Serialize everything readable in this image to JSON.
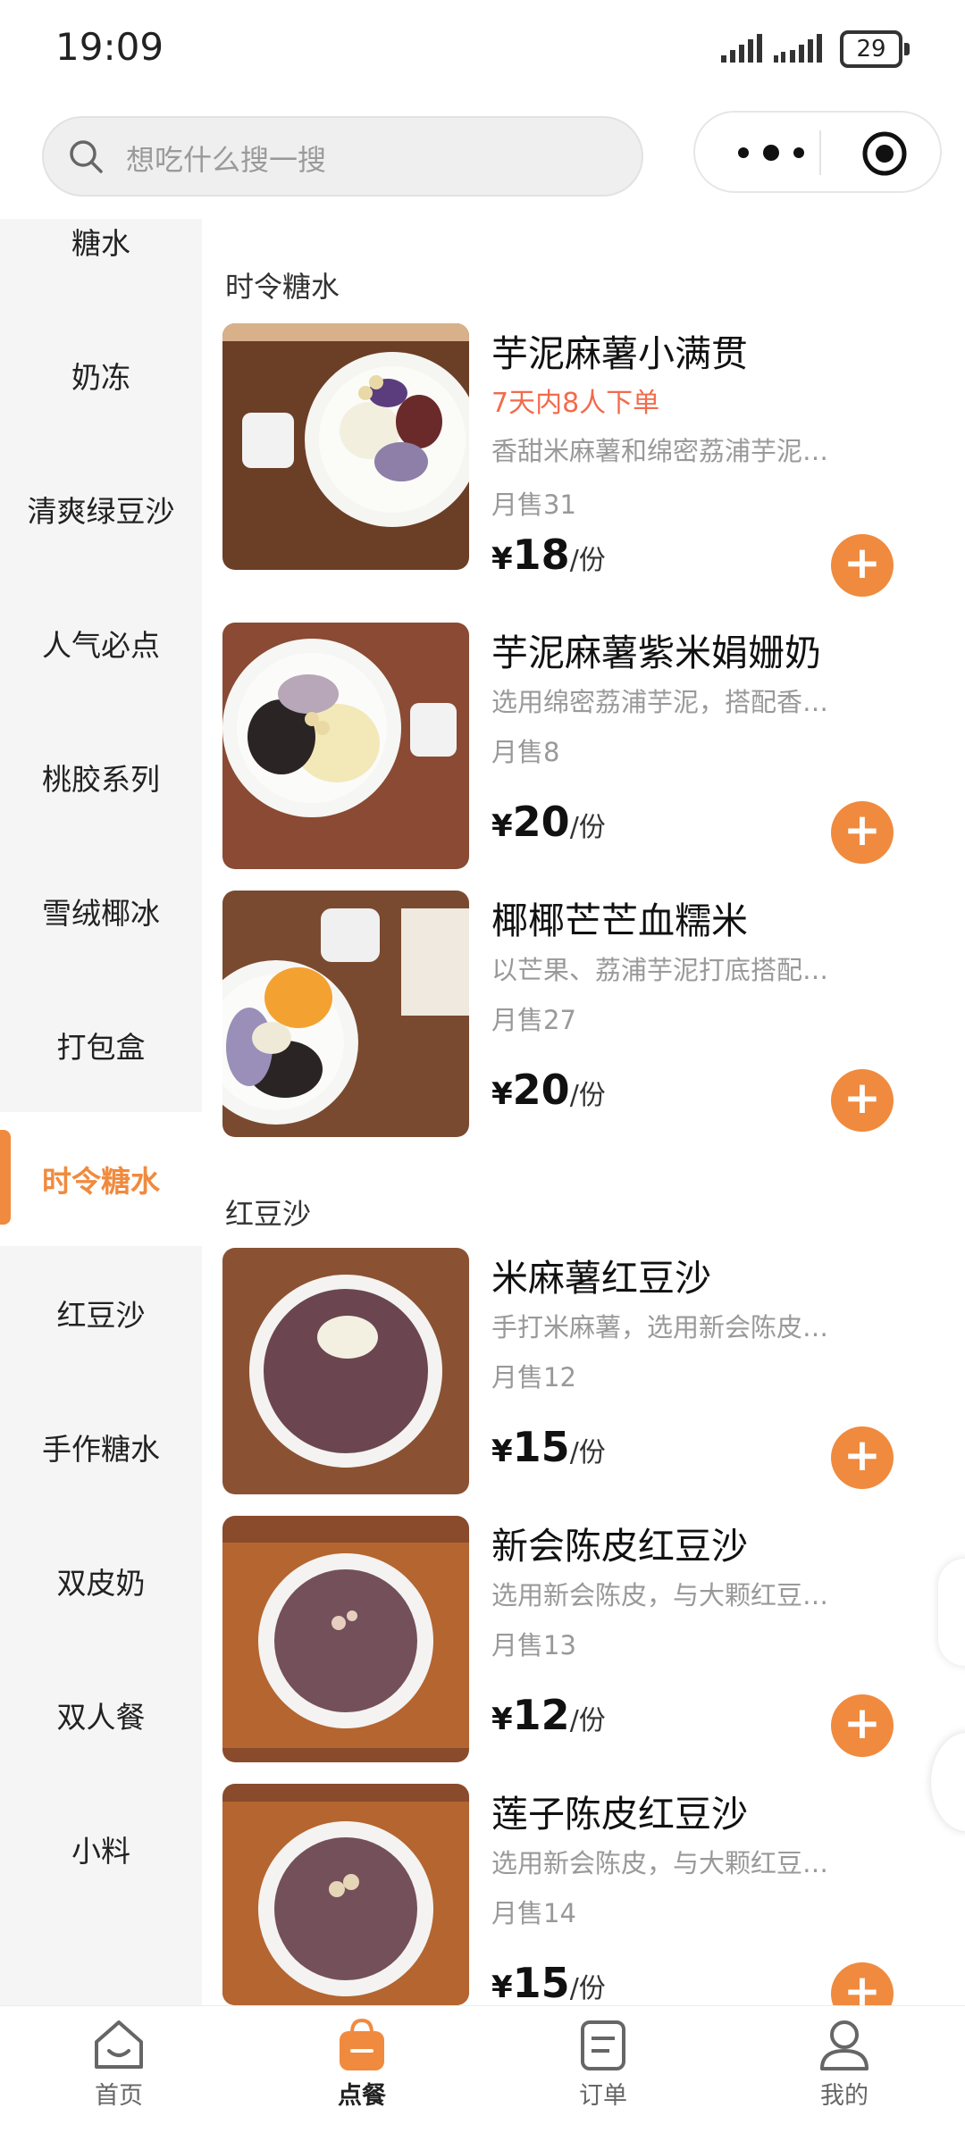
{
  "status_bar": {
    "time": "19:09",
    "battery": "29"
  },
  "search": {
    "placeholder": "想吃什么搜一搜"
  },
  "sidebar": {
    "items": [
      {
        "label": "糖水"
      },
      {
        "label": "奶冻"
      },
      {
        "label": "清爽绿豆沙"
      },
      {
        "label": "人气必点"
      },
      {
        "label": "桃胶系列"
      },
      {
        "label": "雪绒椰冰"
      },
      {
        "label": "打包盒"
      },
      {
        "label": "时令糖水",
        "active": true
      },
      {
        "label": "红豆沙"
      },
      {
        "label": "手作糖水"
      },
      {
        "label": "双皮奶"
      },
      {
        "label": "双人餐"
      },
      {
        "label": "小料"
      }
    ]
  },
  "sections": [
    {
      "title": "时令糖水",
      "items": [
        {
          "name": "芋泥麻薯小满贯",
          "tag": "7天内8人下单",
          "desc": "香甜米麻薯和绵密荔浦芋泥结…",
          "sales": "月售31",
          "currency": "¥",
          "price": "18",
          "unit": "/份"
        },
        {
          "name": "芋泥麻薯紫米娟姗奶",
          "desc": "选用绵密荔浦芋泥，搭配香糯…",
          "sales": "月售8",
          "currency": "¥",
          "price": "20",
          "unit": "/份"
        },
        {
          "name": "椰椰芒芒血糯米",
          "desc": "以芒果、荔浦芋泥打底搭配米…",
          "sales": "月售27",
          "currency": "¥",
          "price": "20",
          "unit": "/份"
        }
      ]
    },
    {
      "title": "红豆沙",
      "items": [
        {
          "name": "米麻薯红豆沙",
          "desc": "手打米麻薯，选用新会陈皮，…",
          "sales": "月售12",
          "currency": "¥",
          "price": "15",
          "unit": "/份"
        },
        {
          "name": "新会陈皮红豆沙",
          "desc": "选用新会陈皮，与大颗红豆熬…",
          "sales": "月售13",
          "currency": "¥",
          "price": "12",
          "unit": "/份"
        },
        {
          "name": "莲子陈皮红豆沙",
          "desc": "选用新会陈皮，与大颗红豆熬…",
          "sales": "月售14",
          "currency": "¥",
          "price": "15",
          "unit": "/份"
        }
      ]
    }
  ],
  "tabbar": {
    "items": [
      {
        "label": "首页",
        "icon": "home-icon"
      },
      {
        "label": "点餐",
        "icon": "order-bag-icon",
        "active": true
      },
      {
        "label": "订单",
        "icon": "receipt-icon"
      },
      {
        "label": "我的",
        "icon": "user-icon"
      }
    ]
  },
  "colors": {
    "accent": "#f08a3e",
    "tag": "#f26b4c",
    "muted": "#999999"
  }
}
